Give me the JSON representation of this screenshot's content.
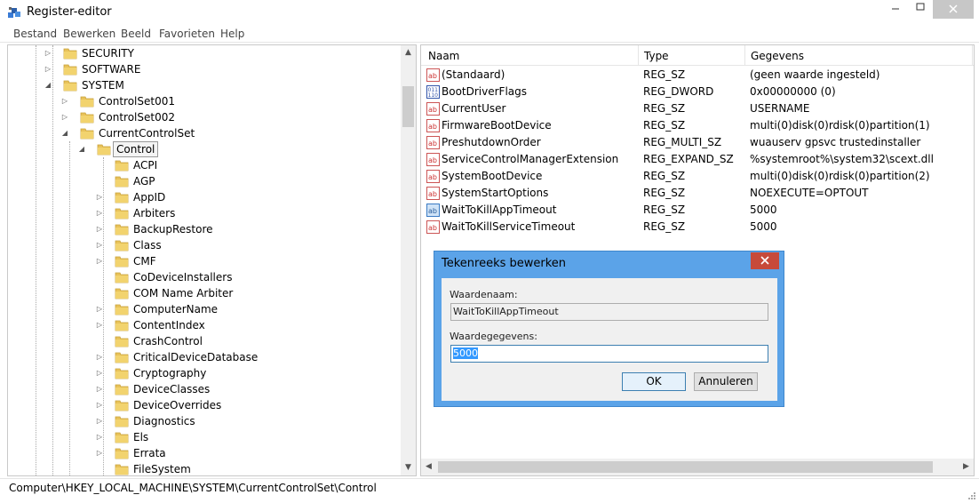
{
  "window": {
    "title": "Register-editor"
  },
  "menu": [
    "Bestand",
    "Bewerken",
    "Beeld",
    "Favorieten",
    "Help"
  ],
  "tree": [
    {
      "label": "SECURITY",
      "level": 0,
      "expander": "collapsed"
    },
    {
      "label": "SOFTWARE",
      "level": 0,
      "expander": "collapsed"
    },
    {
      "label": "SYSTEM",
      "level": 0,
      "expander": "expanded"
    },
    {
      "label": "ControlSet001",
      "level": 1,
      "expander": "collapsed"
    },
    {
      "label": "ControlSet002",
      "level": 1,
      "expander": "collapsed"
    },
    {
      "label": "CurrentControlSet",
      "level": 1,
      "expander": "expanded"
    },
    {
      "label": "Control",
      "level": 2,
      "expander": "expanded",
      "selected": true
    },
    {
      "label": "ACPI",
      "level": 3,
      "expander": "none"
    },
    {
      "label": "AGP",
      "level": 3,
      "expander": "none"
    },
    {
      "label": "AppID",
      "level": 3,
      "expander": "collapsed"
    },
    {
      "label": "Arbiters",
      "level": 3,
      "expander": "collapsed"
    },
    {
      "label": "BackupRestore",
      "level": 3,
      "expander": "collapsed"
    },
    {
      "label": "Class",
      "level": 3,
      "expander": "collapsed"
    },
    {
      "label": "CMF",
      "level": 3,
      "expander": "collapsed"
    },
    {
      "label": "CoDeviceInstallers",
      "level": 3,
      "expander": "none"
    },
    {
      "label": "COM Name Arbiter",
      "level": 3,
      "expander": "none"
    },
    {
      "label": "ComputerName",
      "level": 3,
      "expander": "collapsed"
    },
    {
      "label": "ContentIndex",
      "level": 3,
      "expander": "collapsed"
    },
    {
      "label": "CrashControl",
      "level": 3,
      "expander": "none"
    },
    {
      "label": "CriticalDeviceDatabase",
      "level": 3,
      "expander": "collapsed"
    },
    {
      "label": "Cryptography",
      "level": 3,
      "expander": "collapsed"
    },
    {
      "label": "DeviceClasses",
      "level": 3,
      "expander": "collapsed"
    },
    {
      "label": "DeviceOverrides",
      "level": 3,
      "expander": "collapsed"
    },
    {
      "label": "Diagnostics",
      "level": 3,
      "expander": "collapsed"
    },
    {
      "label": "Els",
      "level": 3,
      "expander": "collapsed"
    },
    {
      "label": "Errata",
      "level": 3,
      "expander": "collapsed"
    },
    {
      "label": "FileSystem",
      "level": 3,
      "expander": "none"
    }
  ],
  "list": {
    "columns": [
      "Naam",
      "Type",
      "Gegevens"
    ],
    "rows": [
      {
        "name": "(Standaard)",
        "type": "REG_SZ",
        "data": "(geen waarde ingesteld)",
        "icon": "string-value-icon"
      },
      {
        "name": "BootDriverFlags",
        "type": "REG_DWORD",
        "data": "0x00000000 (0)",
        "icon": "binary-value-icon"
      },
      {
        "name": "CurrentUser",
        "type": "REG_SZ",
        "data": "USERNAME",
        "icon": "string-value-icon"
      },
      {
        "name": "FirmwareBootDevice",
        "type": "REG_SZ",
        "data": "multi(0)disk(0)rdisk(0)partition(1)",
        "icon": "string-value-icon"
      },
      {
        "name": "PreshutdownOrder",
        "type": "REG_MULTI_SZ",
        "data": "wuauserv gpsvc trustedinstaller",
        "icon": "string-value-icon"
      },
      {
        "name": "ServiceControlManagerExtension",
        "type": "REG_EXPAND_SZ",
        "data": "%systemroot%\\system32\\scext.dll",
        "icon": "string-value-icon"
      },
      {
        "name": "SystemBootDevice",
        "type": "REG_SZ",
        "data": "multi(0)disk(0)rdisk(0)partition(2)",
        "icon": "string-value-icon"
      },
      {
        "name": "SystemStartOptions",
        "type": "REG_SZ",
        "data": " NOEXECUTE=OPTOUT",
        "icon": "string-value-icon"
      },
      {
        "name": "WaitToKillAppTimeout",
        "type": "REG_SZ",
        "data": "5000",
        "icon": "string-value-icon",
        "selected": true
      },
      {
        "name": "WaitToKillServiceTimeout",
        "type": "REG_SZ",
        "data": "5000",
        "icon": "string-value-icon"
      }
    ]
  },
  "status": {
    "path": "Computer\\HKEY_LOCAL_MACHINE\\SYSTEM\\CurrentControlSet\\Control"
  },
  "dialog": {
    "title": "Tekenreeks bewerken",
    "name_label": "Waardenaam:",
    "name_value": "WaitToKillAppTimeout",
    "data_label": "Waardegegevens:",
    "data_value": "5000",
    "ok_label": "OK",
    "cancel_label": "Annuleren"
  },
  "colors": {
    "dialog_frame": "#5ba3e8",
    "close_red": "#c74a3a",
    "selection_blue": "#3399ff"
  }
}
